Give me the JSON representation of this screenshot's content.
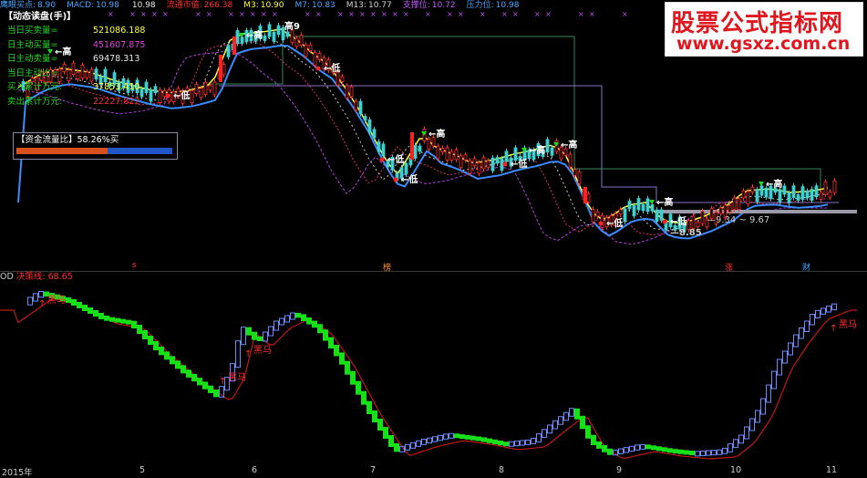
{
  "top_bar": {
    "items": [
      {
        "label": "鹰眼买点:",
        "value": "8.90",
        "color": "#4aa3ff"
      },
      {
        "label": "MACD:",
        "value": "10.98",
        "color": "#4aa3ff"
      },
      {
        "label": "",
        "value": "10.98",
        "color": "#e8e8e8"
      },
      {
        "label": "流通市值:",
        "value": "266.38",
        "color": "#ff3030"
      },
      {
        "label": "M3:",
        "value": "10.90",
        "color": "#ffff40"
      },
      {
        "label": "M7:",
        "value": "10.83",
        "color": "#4aa3ff"
      },
      {
        "label": "M13:",
        "value": "10.77",
        "color": "#cfcfcf"
      },
      {
        "label": "支撑位:",
        "value": "10.72",
        "color": "#c060ff"
      },
      {
        "label": "压力位:",
        "value": "10.98",
        "color": "#4aa3ff"
      }
    ]
  },
  "info_panel": {
    "title": "【动态读盘(手)】",
    "rows": [
      {
        "label": "当日买卖量=",
        "value": "521086.188",
        "label_color": "#28d828",
        "value_color": "#ffff40"
      },
      {
        "label": "日主动买量=",
        "value": "451607.875",
        "label_color": "#28d828",
        "value_color": "#e040e0"
      },
      {
        "label": "日主动卖量=",
        "value": "69478.313",
        "label_color": "#28d828",
        "value_color": "#e8e8e8"
      },
      {
        "label": "当日主动比=",
        "value": "",
        "label_color": "#28d828",
        "value_color": "#e8e8e8"
      },
      {
        "label": "买入累计万元:",
        "value": "37853.410",
        "label_color": "#28d828",
        "value_color": "#ffff40"
      },
      {
        "label": "卖出累计万元:",
        "value": "22227.822",
        "label_color": "#28d828",
        "value_color": "#ff3030"
      }
    ]
  },
  "flow_box": {
    "label": "【资金流量比】",
    "value": "58.26%买",
    "buy_ratio": 0.5826,
    "buy_color": "#d8501c",
    "sell_color": "#2156c8"
  },
  "watermark": {
    "title": "股票公式指标网",
    "url": "www.gsxz.com.cn"
  },
  "lower_panel": {
    "prefix": "OD",
    "label": "决策线:",
    "value": "68.65"
  },
  "annotations": {
    "high": "高",
    "high9": "高9",
    "low": "低",
    "black_horse": "黑马",
    "range_text": "9.34 ~ 9.67",
    "price_885": "8.85"
  },
  "event_markers": [
    "s",
    "榜",
    "涨",
    "财"
  ],
  "x_axis": [
    "2015年",
    "5",
    "6",
    "7",
    "8",
    "9",
    "10",
    "11"
  ],
  "colors": {
    "up": "#ff3030",
    "down": "#3cd0d0",
    "green_block": "#18e018",
    "outline_block": "#6a8cff",
    "decision_line": "#c01818"
  }
}
